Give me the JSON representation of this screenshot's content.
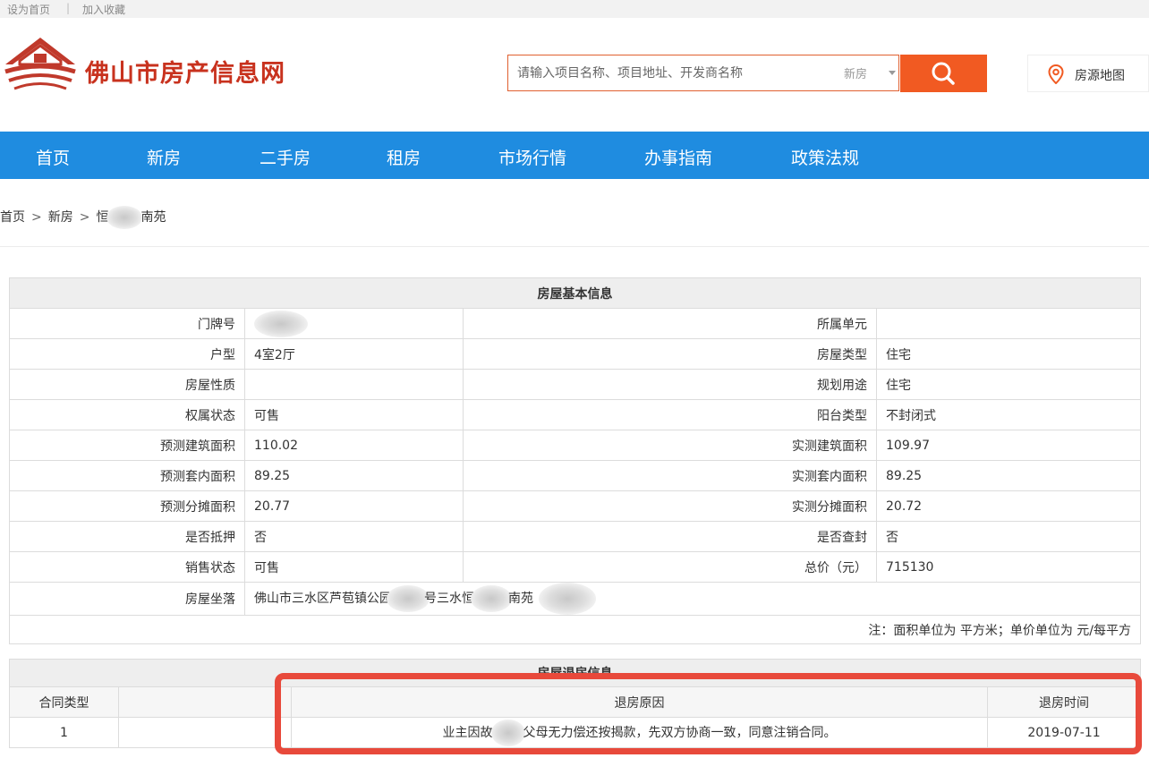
{
  "topbar": {
    "set_home": "设为首页",
    "divider": "|",
    "bookmark": "加入收藏"
  },
  "header": {
    "site_title": "佛山市房产信息网",
    "search": {
      "placeholder": "请输入项目名称、项目地址、开发商名称",
      "type_selected": "新房"
    },
    "map_link": "房源地图"
  },
  "nav": {
    "items": [
      "首页",
      "新房",
      "二手房",
      "租房",
      "市场行情",
      "办事指南",
      "政策法规"
    ]
  },
  "breadcrumb": {
    "home": "首页",
    "sep": ">",
    "category": "新房",
    "project_prefix": "恒",
    "project_suffix": "南苑"
  },
  "basic_info": {
    "title": "房屋基本信息",
    "rows": [
      {
        "l_label": "门牌号",
        "l_value": "",
        "r_label": "所属单元",
        "r_value": ""
      },
      {
        "l_label": "户型",
        "l_value": "4室2厅",
        "r_label": "房屋类型",
        "r_value": "住宅"
      },
      {
        "l_label": "房屋性质",
        "l_value": "",
        "r_label": "规划用途",
        "r_value": "住宅"
      },
      {
        "l_label": "权属状态",
        "l_value": "可售",
        "r_label": "阳台类型",
        "r_value": "不封闭式"
      },
      {
        "l_label": "预测建筑面积",
        "l_value": "110.02",
        "r_label": "实测建筑面积",
        "r_value": "109.97"
      },
      {
        "l_label": "预测套内面积",
        "l_value": "89.25",
        "r_label": "实测套内面积",
        "r_value": "89.25"
      },
      {
        "l_label": "预测分摊面积",
        "l_value": "20.77",
        "r_label": "实测分摊面积",
        "r_value": "20.72"
      },
      {
        "l_label": "是否抵押",
        "l_value": "否",
        "r_label": "是否查封",
        "r_value": "否"
      },
      {
        "l_label": "销售状态",
        "l_value": "可售",
        "r_label": "总价（元）",
        "r_value": "715130"
      }
    ],
    "address_label": "房屋坐落",
    "address_part1": "佛山市三水区芦苞镇公园",
    "address_part2": "号三水恒",
    "address_part3": "南苑",
    "note": "注：面积单位为 平方米；单价单位为 元/每平方"
  },
  "return_info": {
    "title": "房屋退房信息",
    "headers": {
      "contract_type": "合同类型",
      "reason": "退房原因",
      "date": "退房时间"
    },
    "row": {
      "contract_type": "1",
      "reason_prefix": "业主因故",
      "reason_suffix": "父母无力偿还按揭款，先双方协商一致，同意注销合同。",
      "date": "2019-07-11"
    }
  },
  "colors": {
    "brand_red": "#c8321e",
    "nav_blue": "#1f8ce0",
    "search_orange": "#f15a22",
    "highlight_red": "#e8493b"
  }
}
